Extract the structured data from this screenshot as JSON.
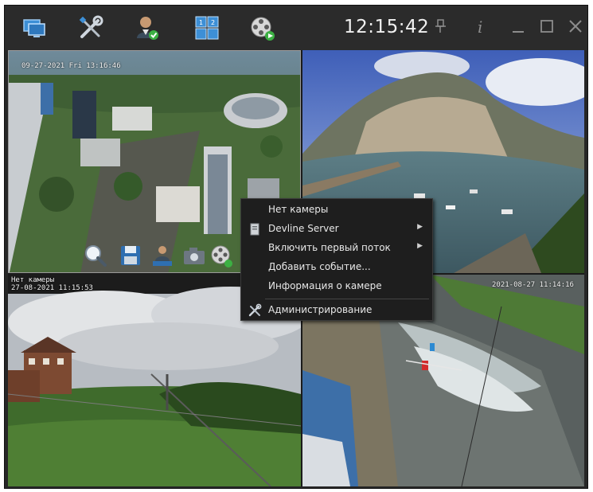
{
  "toolbar": {
    "icons": [
      "monitors-icon",
      "tools-icon",
      "user-check-icon",
      "layout-grid-icon",
      "film-reel-play-icon"
    ],
    "clock": "12:15:42",
    "window_controls": [
      "pin-icon",
      "info-icon",
      "minimize-icon",
      "maximize-icon",
      "close-icon"
    ]
  },
  "cameras": {
    "cam1": {
      "timestamp": "09-27-2021 Fri 13:16:46"
    },
    "cam2": {
      "timestamp": ""
    },
    "cam3": {
      "caption": "Нет камеры",
      "timestamp": "27-08-2021 11:15:53"
    },
    "cam4": {
      "timestamp": "2021-08-27 11:14:16"
    }
  },
  "cam_toolbar": {
    "icons": [
      "zoom-icon",
      "save-icon",
      "user-upload-icon",
      "camera-snapshot-icon",
      "film-reel-icon"
    ]
  },
  "context_menu": {
    "items": [
      {
        "label": "Нет камеры",
        "icon": "",
        "submenu": false
      },
      {
        "label": "Devline Server",
        "icon": "server-icon",
        "submenu": true
      },
      {
        "label": "Включить первый поток",
        "icon": "",
        "submenu": true
      },
      {
        "label": "Добавить событие...",
        "icon": "",
        "submenu": false
      },
      {
        "label": "Информация о камере",
        "icon": "",
        "submenu": false
      },
      {
        "label": "Администрирование",
        "icon": "tools-icon",
        "submenu": false
      }
    ]
  },
  "colors": {
    "toolbar_bg": "#2b2b2b",
    "menu_bg": "#1e1e1e",
    "accent_green": "#3cb043",
    "icon_blue": "#3d8fd6"
  }
}
